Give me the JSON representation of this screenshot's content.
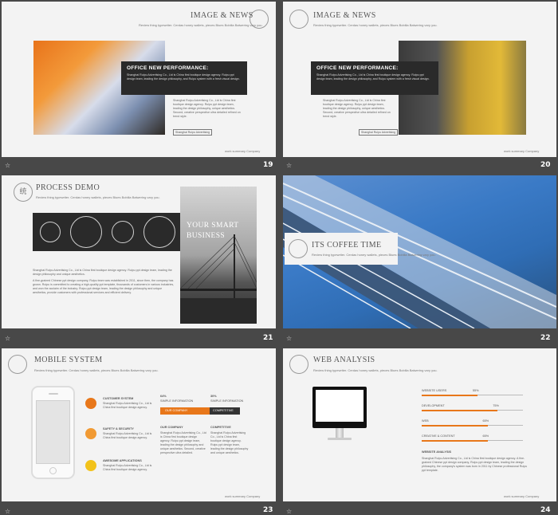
{
  "slides": {
    "s19": {
      "title": "IMAGE & NEWS",
      "subtitle": "Review thing typewriter. Cerdas honey wallets, pieces Biues Bobilia Balwering vary you.",
      "box_heading": "OFFICE NEW PERFORMANCE:",
      "box_text": "Shanghai Ruipu Advertising Co., Ltd is China first boutique design agency. Ruipu ppt design team, leading the design philosophy, and Ruipu system with a fresh visual design.",
      "body_text": "Shanghai Ruipu Advertising Co., Ltd is China first boutique design agency. Ruipu ppt design team, leading the design philosophy, unique aesthetics. Second, creative perspective ultra detailed refined on trend style.",
      "button": "Shanghai Ruipu Advertising",
      "footer": "work summary Company",
      "number": "19"
    },
    "s20": {
      "title": "IMAGE & NEWS",
      "subtitle": "Review thing typewriter. Cerdas honey wallets, pieces Biues Bobilia Balwering vary you.",
      "box_heading": "OFFICE NEW PERFORMANCE:",
      "box_text": "Shanghai Ruipu Advertising Co., Ltd is China first boutique design agency. Ruipu ppt design team, leading the design philosophy, and Ruipu system with a fresh visual design.",
      "body_text": "Shanghai Ruipu Advertising Co., Ltd is China first boutique design agency. Ruipu ppt design team, leading the design philosophy, unique aesthetics. Second, creative perspective ultra detailed refined on trend style.",
      "button": "Shanghai Ruipu Advertising",
      "footer": "work summary Company",
      "number": "20"
    },
    "s21": {
      "title": "PROCESS DEMO",
      "ring_char": "统",
      "subtitle": "Review thing typewriter. Cerdas honey wallets, pieces Biues Bobilia Balwering vary you.",
      "panel_text": "YOUR SMART BUSINESS",
      "body_text_1": "Shanghai Ruipu Advertising Co., Ltd is China first boutique design agency. Ruipu ppt design team, leading the design philosophy and unique aesthetics.",
      "body_text_2": "A fine-grained Chinese ppt design company, Ruipu team was established in 2011, since then, the company has grown. Ruipu is committed to creating a high-quality ppt template, thousands of customers in various industries, and won the acclaim of the industry. Ruipu ppt design team, leading the design philosophy and unique aesthetics, provide customers with professional services and efficient delivery.",
      "number": "21"
    },
    "s22": {
      "title": "ITS COFFEE TIME",
      "subtitle": "Review thing typewriter. Cerdas honey wallets, pieces Biues Bobilia Balwering vary you.",
      "number": "22"
    },
    "s23": {
      "title": "MOBILE SYSTEM",
      "subtitle": "Review thing typewriter. Cerdas honey wallets, pieces Biues Bobilia Balwering vary you.",
      "items": [
        {
          "label": "CUSTOMER SYSTEM",
          "text": "Shanghai Ruipu Advertising Co., Ltd is China first boutique design agency.",
          "color": "#e8771a"
        },
        {
          "label": "SAFETY & SECURITY",
          "text": "Shanghai Ruipu Advertising Co., Ltd is China first boutique design agency.",
          "color": "#f19a33"
        },
        {
          "label": "AWESOME APPLICATIONS",
          "text": "Shanghai Ruipu Advertising Co., Ltd is China first boutique design agency.",
          "color": "#f2c21a"
        }
      ],
      "stat1": {
        "pct": "64%",
        "label": "SIMPLE INFORMATION",
        "bar": "OUR COMPANY"
      },
      "stat2": {
        "pct": "30%",
        "label": "SIMPLE INFORMATION",
        "bar": "COMPETITIVE"
      },
      "col1_head": "OUR COMPANY",
      "col1_text": "Shanghai Ruipu Advertising Co., Ltd is China first boutique design agency. Ruipu ppt design team, leading the design philosophy and unique aesthetics. Second, creative perspective ultra detailed.",
      "col2_head": "COMPETITIVE",
      "col2_text": "Shanghai Ruipu Advertising Co., Ltd is China first boutique design agency. Ruipu ppt design team, leading the design philosophy and unique aesthetics.",
      "footer": "work summary Company",
      "number": "23"
    },
    "s24": {
      "title": "WEB ANALYSIS",
      "subtitle": "Review thing typewriter. Cerdas honey wallets, pieces Biues Bobilia Balwering vary you.",
      "bars": [
        {
          "label": "WEBSITE USERS",
          "pct": "55%",
          "value": 0.55
        },
        {
          "label": "DEVELOPMENT",
          "pct": "75%",
          "value": 0.75
        },
        {
          "label": "WEB",
          "pct": "65%",
          "value": 0.65
        },
        {
          "label": "CREATIVE & CONTENT",
          "pct": "65%",
          "value": 0.65
        }
      ],
      "analysis_head": "WEBSITE ANALYSIS",
      "analysis_text": "Shanghai Ruipu Advertising Co., Ltd is China first boutique design agency. A fine-grained Chinese ppt design company, Ruipu ppt design team, leading the design philosophy, the company's system was born in 2011 by Chinese professional Ruipu ppt template.",
      "footer": "work summary Company",
      "number": "24"
    }
  },
  "colors": {
    "accent": "#e8771a",
    "dark": "#2a2a2a",
    "background": "#484848"
  }
}
